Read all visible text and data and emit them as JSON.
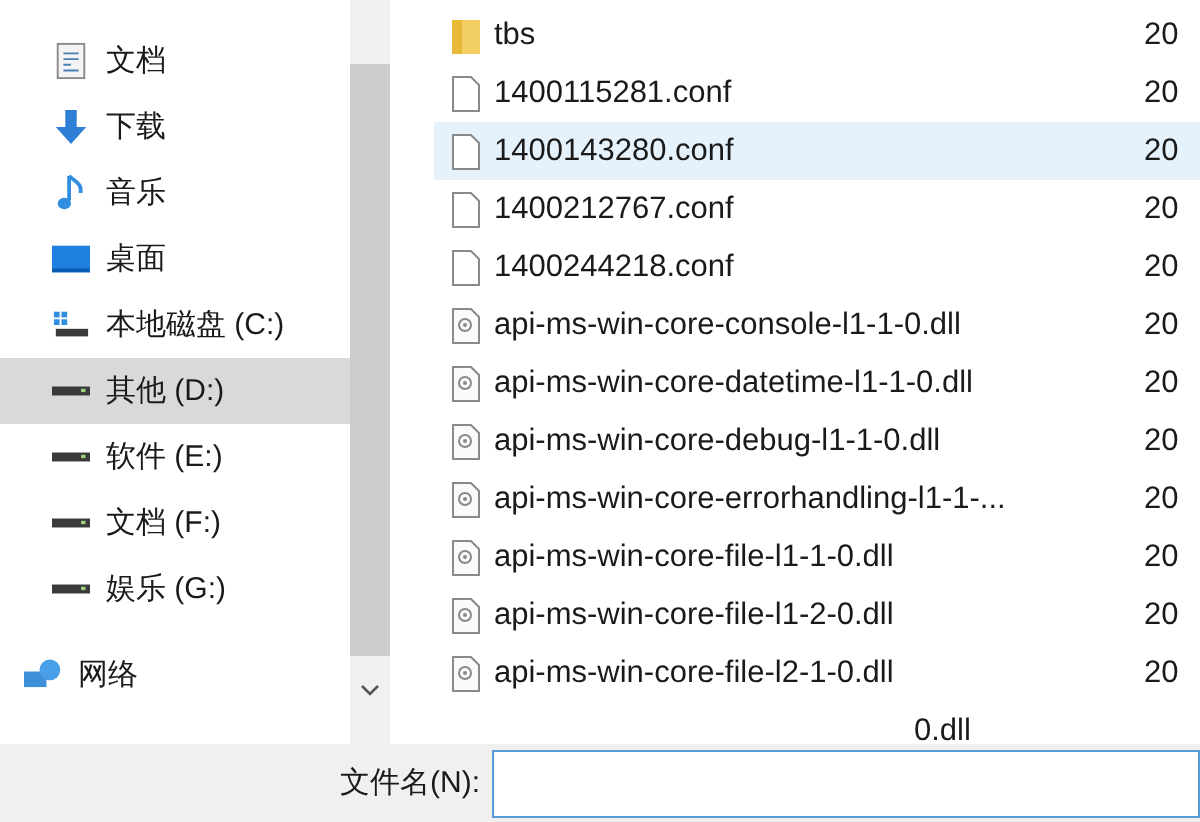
{
  "sidebar": {
    "items": [
      {
        "label": "文档",
        "kind": "documents",
        "selected": false
      },
      {
        "label": "下载",
        "kind": "downloads",
        "selected": false
      },
      {
        "label": "音乐",
        "kind": "music",
        "selected": false
      },
      {
        "label": "桌面",
        "kind": "desktop",
        "selected": false
      },
      {
        "label": "本地磁盘 (C:)",
        "kind": "system-drive",
        "selected": false
      },
      {
        "label": "其他 (D:)",
        "kind": "drive",
        "selected": true
      },
      {
        "label": "软件 (E:)",
        "kind": "drive",
        "selected": false
      },
      {
        "label": "文档 (F:)",
        "kind": "drive",
        "selected": false
      },
      {
        "label": "娱乐 (G:)",
        "kind": "drive",
        "selected": false
      },
      {
        "label": "网络",
        "kind": "network",
        "selected": false
      }
    ]
  },
  "files": {
    "rows": [
      {
        "name": "tbs",
        "kind": "folder",
        "date": "20",
        "selected": false
      },
      {
        "name": "1400115281.conf",
        "kind": "file",
        "date": "20",
        "selected": false
      },
      {
        "name": "1400143280.conf",
        "kind": "file",
        "date": "20",
        "selected": true
      },
      {
        "name": "1400212767.conf",
        "kind": "file",
        "date": "20",
        "selected": false
      },
      {
        "name": "1400244218.conf",
        "kind": "file",
        "date": "20",
        "selected": false
      },
      {
        "name": "api-ms-win-core-console-l1-1-0.dll",
        "kind": "dll",
        "date": "20",
        "selected": false
      },
      {
        "name": "api-ms-win-core-datetime-l1-1-0.dll",
        "kind": "dll",
        "date": "20",
        "selected": false
      },
      {
        "name": "api-ms-win-core-debug-l1-1-0.dll",
        "kind": "dll",
        "date": "20",
        "selected": false
      },
      {
        "name": "api-ms-win-core-errorhandling-l1-1-...",
        "kind": "dll",
        "date": "20",
        "selected": false
      },
      {
        "name": "api-ms-win-core-file-l1-1-0.dll",
        "kind": "dll",
        "date": "20",
        "selected": false
      },
      {
        "name": "api-ms-win-core-file-l1-2-0.dll",
        "kind": "dll",
        "date": "20",
        "selected": false
      },
      {
        "name": "api-ms-win-core-file-l2-1-0.dll",
        "kind": "dll",
        "date": "20",
        "selected": false
      },
      {
        "name": "0.dll",
        "kind": "partial",
        "date": "",
        "selected": false
      }
    ]
  },
  "filename": {
    "label": "文件名(N):"
  }
}
